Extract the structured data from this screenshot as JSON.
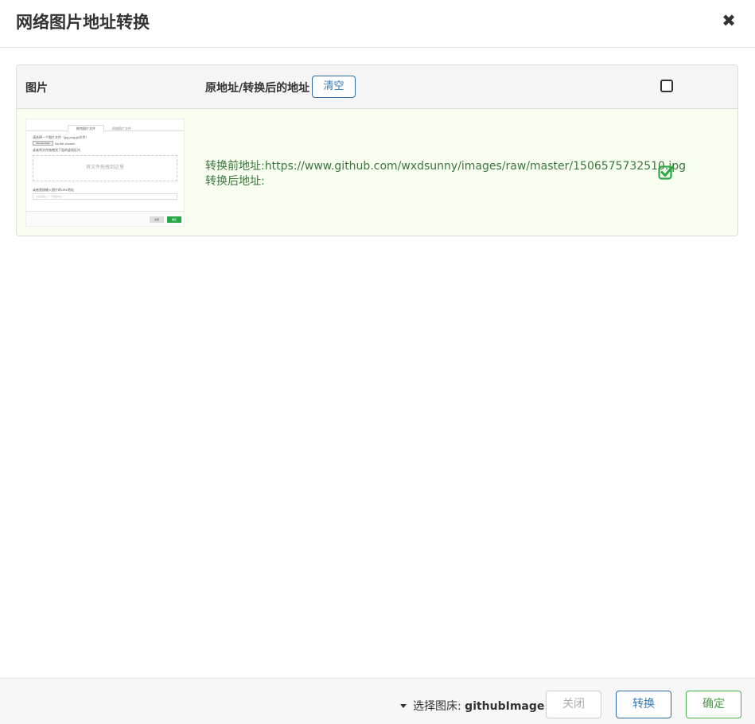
{
  "header": {
    "title": "网络图片地址转换",
    "close_glyph": "✖"
  },
  "table": {
    "col_image": "图片",
    "col_address": "原地址/转换后的地址",
    "clear_label": "清空",
    "rows": [
      {
        "before_label": "转换前地址:",
        "before_url": "https://www.github.com/wxdsunny/images/raw/master/1506575732510.jpg",
        "after_label": "转换后地址:",
        "after_url": "",
        "checked": true,
        "thumbnail": {
          "tab_active": "拖曳图片文件",
          "tab_other": "网络图片文件",
          "line1": "请选择一个图片文件（jpg,png,gif文件）",
          "choose_label": "Choose Files",
          "no_file": "No file chosen",
          "line2": "或者将文件拖拽到下面的虚线区内",
          "dropzone": "将文件拖拽到这里",
          "line3": "或者直接输入图片的URL地址:",
          "url_placeholder": "请在此输入一个网络地址",
          "btn_close": "关闭",
          "btn_ok": "确定"
        }
      }
    ]
  },
  "footer": {
    "store_prefix": "选择图床:",
    "store_value": "githubImage",
    "close_label": "关闭",
    "convert_label": "转换",
    "ok_label": "确定"
  },
  "colors": {
    "row_success_bg": "#f8fef0",
    "success_text": "#3c763d",
    "checkbox_green": "#28a745",
    "primary": "#337ab7"
  },
  "icons": {
    "close": "close-icon",
    "checkbox_empty": "checkbox-empty-icon",
    "checkbox_checked": "checkbox-checked-icon",
    "caret": "caret-down-icon"
  }
}
